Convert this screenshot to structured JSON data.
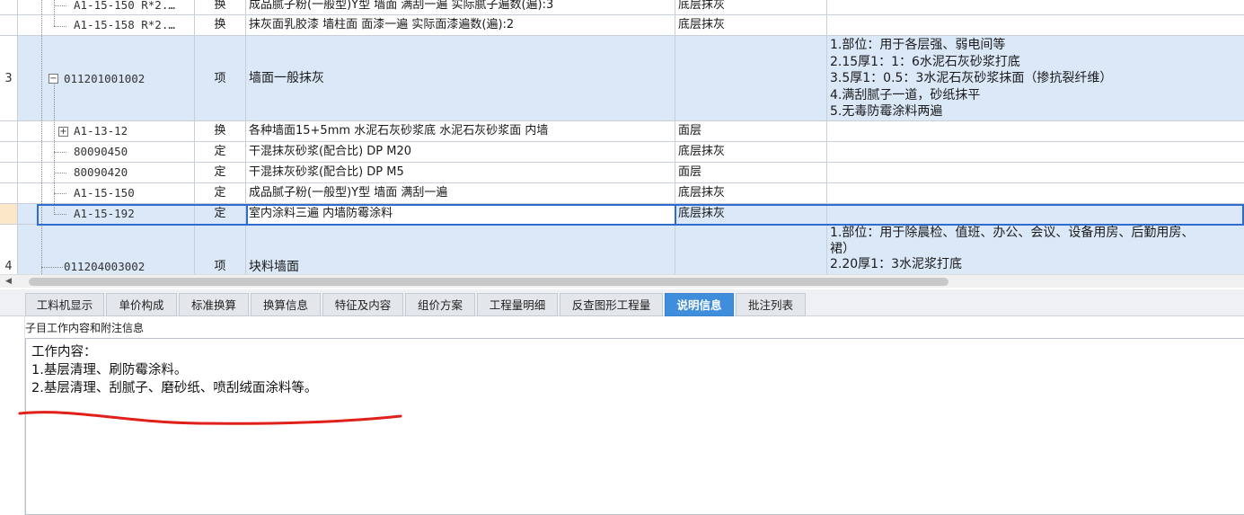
{
  "grid": {
    "rows": [
      {
        "idx": "",
        "code": "A1-15-150 R*2.…",
        "type": "换",
        "name": "成品腻子粉(一般型)Y型 墙面 满刮一遍  实际腻子遍数(遍):3",
        "unit": "底层抹灰",
        "feat": ""
      },
      {
        "idx": "",
        "code": "A1-15-158 R*2.…",
        "type": "换",
        "name": "抹灰面乳胶漆 墙柱面 面漆一遍  实际面漆遍数(遍):2",
        "unit": "底层抹灰",
        "feat": ""
      },
      {
        "idx": "3",
        "code": "011201001002",
        "type": "项",
        "name": "墙面一般抹灰",
        "unit": "",
        "feat": [
          "1.部位：用于各层强、弱电间等",
          "2.15厚1：1：6水泥石灰砂浆打底",
          "3.5厚1：0.5：3水泥石灰砂浆抹面（掺抗裂纤维）",
          "4.满刮腻子一道，砂纸抹平",
          "5.无毒防霉涂料两遍"
        ]
      },
      {
        "idx": "",
        "code": "A1-13-12",
        "type": "换",
        "name": "各种墙面15+5mm 水泥石灰砂浆底 水泥石灰砂浆面 内墙",
        "unit": "面层",
        "feat": ""
      },
      {
        "idx": "",
        "code": "80090450",
        "type": "定",
        "name": "干混抹灰砂浆(配合比) DP M20",
        "unit": "底层抹灰",
        "feat": ""
      },
      {
        "idx": "",
        "code": "80090420",
        "type": "定",
        "name": "干混抹灰砂浆(配合比) DP M5",
        "unit": "面层",
        "feat": ""
      },
      {
        "idx": "",
        "code": "A1-15-150",
        "type": "定",
        "name": "成品腻子粉(一般型)Y型 墙面 满刮一遍",
        "unit": "底层抹灰",
        "feat": ""
      },
      {
        "idx": "",
        "code": "A1-15-192",
        "type": "定",
        "name": "室内涂料三遍 内墙防霉涂料",
        "unit": "底层抹灰",
        "feat": ""
      },
      {
        "idx": "4",
        "code": "011204003002",
        "type": "项",
        "name": "块料墙面",
        "unit": "",
        "feat": [
          "1.部位：用于除晨检、值班、办公、会议、设备用房、后勤用房、",
          "裙）",
          "2.20厚1：3水泥浆打底"
        ]
      }
    ]
  },
  "tabs": [
    {
      "label": "工料机显示"
    },
    {
      "label": "单价构成"
    },
    {
      "label": "标准换算"
    },
    {
      "label": "换算信息"
    },
    {
      "label": "特征及内容"
    },
    {
      "label": "组价方案"
    },
    {
      "label": "工程量明细"
    },
    {
      "label": "反查图形工程量"
    },
    {
      "label": "说明信息",
      "active": true
    },
    {
      "label": "批注列表"
    }
  ],
  "panel": {
    "subtitle": "子目工作内容和附注信息",
    "lines": [
      "工作内容：",
      "1.基层清理、刷防霉涂料。",
      "2.基层清理、刮腻子、磨砂纸、喷刮绒面涂料等。"
    ]
  },
  "colors": {
    "row_highlight": "#dbe8f8",
    "tab_active": "#3f8edc",
    "annotation": "#e0201a",
    "selection": "#2f6cd0"
  }
}
